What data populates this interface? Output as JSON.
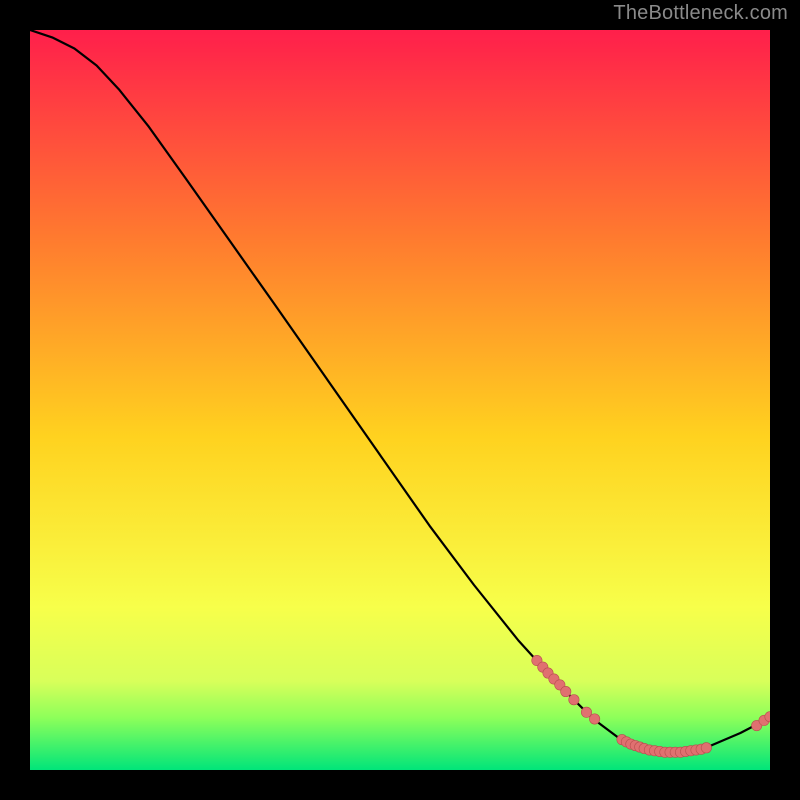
{
  "attribution": "TheBottleneck.com",
  "colors": {
    "gradient_top": "#ff1f4b",
    "gradient_mid1": "#ff7a2f",
    "gradient_mid2": "#ffd21f",
    "gradient_mid3": "#f7ff4a",
    "gradient_green1": "#8cff5a",
    "gradient_green2": "#00e57a",
    "curve_stroke": "#000000",
    "dot_fill": "#e07070",
    "dot_stroke": "#b84f4f"
  },
  "chart_data": {
    "type": "line",
    "title": "",
    "xlabel": "",
    "ylabel": "",
    "xlim": [
      0,
      100
    ],
    "ylim": [
      0,
      100
    ],
    "curve": [
      {
        "x": 0,
        "y": 100
      },
      {
        "x": 3,
        "y": 99
      },
      {
        "x": 6,
        "y": 97.5
      },
      {
        "x": 9,
        "y": 95.2
      },
      {
        "x": 12,
        "y": 92
      },
      {
        "x": 16,
        "y": 87
      },
      {
        "x": 21,
        "y": 80
      },
      {
        "x": 27,
        "y": 71.5
      },
      {
        "x": 33,
        "y": 63
      },
      {
        "x": 40,
        "y": 53
      },
      {
        "x": 47,
        "y": 43
      },
      {
        "x": 54,
        "y": 33
      },
      {
        "x": 60,
        "y": 25
      },
      {
        "x": 66,
        "y": 17.5
      },
      {
        "x": 71,
        "y": 12
      },
      {
        "x": 76,
        "y": 7
      },
      {
        "x": 80,
        "y": 4
      },
      {
        "x": 84,
        "y": 2.4
      },
      {
        "x": 88,
        "y": 2.4
      },
      {
        "x": 92,
        "y": 3.3
      },
      {
        "x": 96,
        "y": 5
      },
      {
        "x": 98.5,
        "y": 6.3
      },
      {
        "x": 100,
        "y": 7.2
      }
    ],
    "cluster_a": [
      {
        "x": 68.5,
        "y": 14.8
      },
      {
        "x": 69.3,
        "y": 13.9
      },
      {
        "x": 70.0,
        "y": 13.1
      },
      {
        "x": 70.8,
        "y": 12.3
      },
      {
        "x": 71.6,
        "y": 11.5
      },
      {
        "x": 72.4,
        "y": 10.6
      },
      {
        "x": 73.5,
        "y": 9.5
      },
      {
        "x": 75.2,
        "y": 7.8
      },
      {
        "x": 76.3,
        "y": 6.9
      }
    ],
    "cluster_b": [
      {
        "x": 80.0,
        "y": 4.1
      },
      {
        "x": 80.6,
        "y": 3.8
      },
      {
        "x": 81.2,
        "y": 3.5
      },
      {
        "x": 81.8,
        "y": 3.3
      },
      {
        "x": 82.4,
        "y": 3.1
      },
      {
        "x": 83.0,
        "y": 2.9
      },
      {
        "x": 83.7,
        "y": 2.7
      },
      {
        "x": 84.4,
        "y": 2.6
      },
      {
        "x": 85.1,
        "y": 2.5
      },
      {
        "x": 85.8,
        "y": 2.4
      },
      {
        "x": 86.5,
        "y": 2.4
      },
      {
        "x": 87.2,
        "y": 2.4
      },
      {
        "x": 87.9,
        "y": 2.4
      },
      {
        "x": 88.6,
        "y": 2.5
      },
      {
        "x": 89.3,
        "y": 2.6
      },
      {
        "x": 90.0,
        "y": 2.7
      },
      {
        "x": 90.7,
        "y": 2.8
      },
      {
        "x": 91.4,
        "y": 3.0
      }
    ],
    "cluster_c": [
      {
        "x": 98.2,
        "y": 6.0
      },
      {
        "x": 99.2,
        "y": 6.7
      },
      {
        "x": 100.0,
        "y": 7.2
      }
    ]
  }
}
